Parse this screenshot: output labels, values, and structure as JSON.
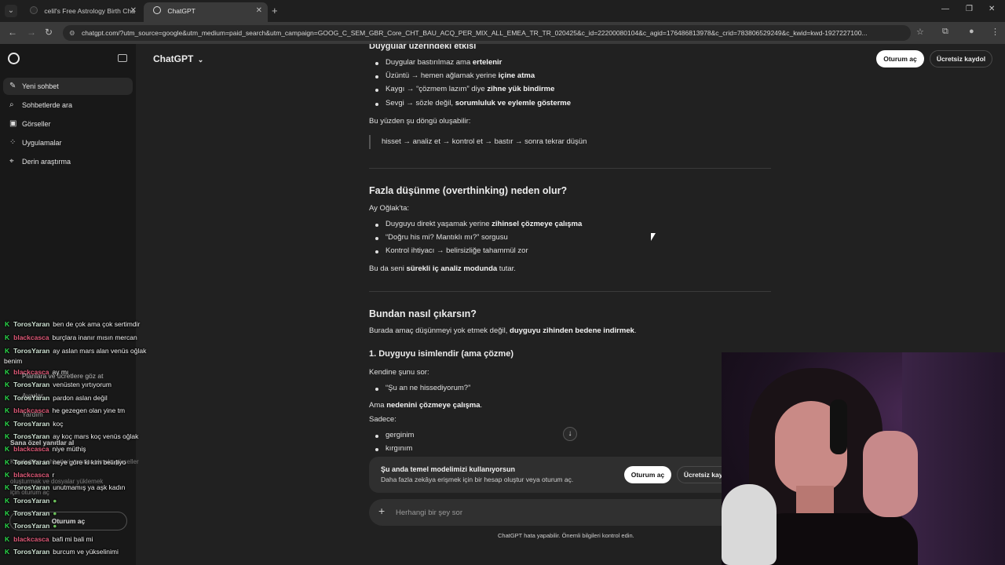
{
  "browser": {
    "tabs": [
      {
        "title": "celil's Free Astrology Birth Cha",
        "active": false
      },
      {
        "title": "ChatGPT",
        "active": true
      }
    ],
    "url": "chatgpt.com/?utm_source=google&utm_medium=paid_search&utm_campaign=GOOG_C_SEM_GBR_Core_CHT_BAU_ACQ_PER_MIX_ALL_EMEA_TR_TR_020425&c_id=22200080104&c_agid=176486813978&c_crid=783806529249&c_kwid=kwd-1927227100..."
  },
  "sidebar": {
    "items": [
      {
        "label": "Yeni sohbet",
        "icon": "edit-icon"
      },
      {
        "label": "Sohbetlerde ara",
        "icon": "search-icon"
      },
      {
        "label": "Görseller",
        "icon": "image-icon"
      },
      {
        "label": "Uygulamalar",
        "icon": "apps-icon"
      },
      {
        "label": "Derin araştırma",
        "icon": "research-icon"
      }
    ]
  },
  "header": {
    "model": "ChatGPT",
    "login": "Oturum aç",
    "signup": "Ücretsiz kaydol"
  },
  "content": {
    "section0_title": "Duygular üzerindeki etkisi",
    "s0_li": [
      {
        "pre": "Duygular bastırılmaz ama ",
        "b": "ertelenir",
        "post": ""
      },
      {
        "pre": "Üzüntü → hemen ağlamak yerine ",
        "b": "içine atma",
        "post": ""
      },
      {
        "pre": "Kaygı → “çözmem lazım” diye ",
        "b": "zihne yük bindirme",
        "post": ""
      },
      {
        "pre": "Sevgi → sözle değil, ",
        "b": "sorumluluk ve eylemle gösterme",
        "post": ""
      }
    ],
    "s0_para": "Bu yüzden şu döngü oluşabilir:",
    "s0_quote": "hisset → analiz et → kontrol et → bastır → sonra tekrar düşün",
    "section1_title": "Fazla düşünme (overthinking) neden olur?",
    "s1_para": "Ay Oğlak’ta:",
    "s1_li": [
      {
        "pre": "Duyguyu direkt yaşamak yerine ",
        "b": "zihinsel çözmeye çalışma",
        "post": ""
      },
      {
        "pre": "“Doğru his mi? Mantıklı mı?” sorgusu",
        "b": "",
        "post": ""
      },
      {
        "pre": "Kontrol ihtiyacı → belirsizliğe tahammül zor",
        "b": "",
        "post": ""
      }
    ],
    "s1_end": {
      "pre": "Bu da seni ",
      "b": "sürekli iç analiz modunda",
      "post": " tutar."
    },
    "section2_title": "Bundan nasıl çıkarsın?",
    "s2_para": {
      "pre": "Burada amaç düşünmeyi yok etmek değil, ",
      "b": "duyguyu zihinden bedene indirmek",
      "post": "."
    },
    "section3_title": "1. Duyguyu isimlendir (ama çözme)",
    "s3_para": "Kendine şunu sor:",
    "s3_li": [
      "“Şu an ne hissediyorum?”"
    ],
    "s3_para2": {
      "pre": "Ama ",
      "b": "nedenini çözmeye çalışma",
      "post": "."
    },
    "s3_para3": "Sadece:",
    "s3_li2": [
      "gerginim",
      "kırgınım"
    ]
  },
  "banner": {
    "title": "Şu anda temel modelimizi kullanıyorsun",
    "sub": "Daha fazla zekâya erişmek için bir hesap oluştur veya oturum aç.",
    "login": "Oturum aç",
    "signup": "Ücretsiz kaydol"
  },
  "composer": {
    "placeholder": "Herhangi bir şey sor",
    "note": "ChatGPT hata yapabilir. Önemli bilgileri kontrol edin."
  },
  "chat": [
    {
      "user": "TorosYaran",
      "color": "u1",
      "msg": "ben de çok ama çok sertimdir"
    },
    {
      "user": "blackcasca",
      "color": "u2",
      "msg": "burçlara inanır mısın mercan"
    },
    {
      "user": "TorosYaran",
      "color": "u1",
      "msg": "ay aslan mars alan venüs oğlak"
    },
    {
      "user": "blackcasca",
      "color": "u2",
      "msg": "ay mı"
    },
    {
      "user": "TorosYaran",
      "color": "u1",
      "msg": "venüsten yırtıyorum"
    },
    {
      "user": "TorosYaran",
      "color": "u1",
      "msg": "pardon aslan değil"
    },
    {
      "user": "blackcasca",
      "color": "u2",
      "msg": "he gezegen olan yine tm"
    },
    {
      "user": "TorosYaran",
      "color": "u1",
      "msg": "koç"
    },
    {
      "user": "TorosYaran",
      "color": "u1",
      "msg": "ay koç mars koç venüs oğlak"
    },
    {
      "user": "blackcasca",
      "color": "u2",
      "msg": "niye müthiş"
    },
    {
      "user": "TorosYaran",
      "color": "u1",
      "msg": "neye göre ki kim belirliyo"
    },
    {
      "user": "blackcasca",
      "color": "u2",
      "msg": "r"
    },
    {
      "user": "TorosYaran",
      "color": "u1",
      "msg": "unutmamış ya aşk kadın"
    },
    {
      "user": "TorosYaran",
      "color": "u1",
      "msg": ""
    },
    {
      "user": "TorosYaran",
      "color": "u1",
      "msg": ""
    },
    {
      "user": "TorosYaran",
      "color": "u1",
      "msg": ""
    },
    {
      "user": "blackcasca",
      "color": "u2",
      "msg": "bafi mi bali mi"
    },
    {
      "user": "TorosYaran",
      "color": "u1",
      "msg": "burcum ve yükselinimi"
    }
  ],
  "chat_extra": {
    "wrap": "benim",
    "sidebar_ghost": [
      "Planlara ve ücretlere göz at",
      "Ayarlar",
      "Yardım",
      "Sana özel yanıtlar al",
      "Kaydedilen sohbetleri yanıtlar almak, görseller",
      "oluşturmak ve dosyalar yüklemek",
      "için oturum aç",
      "Oturum aç"
    ]
  }
}
